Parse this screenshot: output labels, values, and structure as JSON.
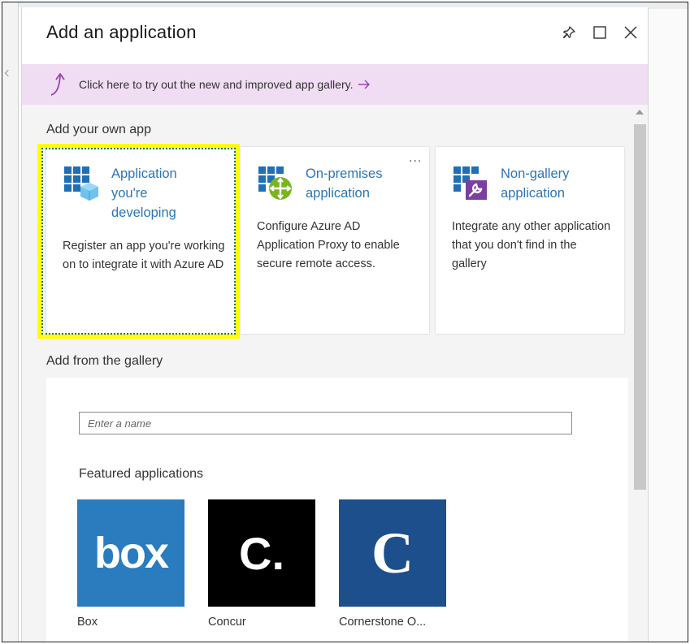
{
  "blade": {
    "title": "Add an application",
    "icons": [
      "pin-icon",
      "maximize-icon",
      "close-icon"
    ]
  },
  "banner": {
    "text": "Click here to try out the new and improved app gallery.",
    "arrow_icon": "curved-arrow-up-icon",
    "go_icon": "arrow-right-icon",
    "background": "#f0dcf3"
  },
  "own_app": {
    "section_title": "Add your own app",
    "more_label": "...",
    "cards": [
      {
        "title_line1": "Application",
        "title_line2": "you're",
        "title_line3": "developing",
        "description": "Register an app you're working on to integrate it with Azure AD",
        "icon": "app-grid-cube-icon",
        "highlighted": true
      },
      {
        "title_line1": "On-premises",
        "title_line2": "application",
        "description": "Configure Azure AD Application Proxy to enable secure remote access.",
        "icon": "app-proxy-icon"
      },
      {
        "title_line1": "Non-gallery",
        "title_line2": "application",
        "description": "Integrate any other application that you don't find in the gallery",
        "icon": "app-wrench-icon"
      }
    ]
  },
  "gallery": {
    "section_title": "Add from the gallery",
    "search_placeholder": "Enter a name",
    "featured_title": "Featured applications",
    "apps": [
      {
        "name": "Box",
        "logo_text": "box",
        "bg": "#2b7bbf"
      },
      {
        "name": "Concur",
        "logo_text": "C.",
        "bg": "#000000"
      },
      {
        "name": "Cornerstone O...",
        "logo_text": "C",
        "bg": "#1d4f8c"
      }
    ]
  },
  "colors": {
    "link_blue": "#2b75b7",
    "highlight": "#ffff00"
  }
}
